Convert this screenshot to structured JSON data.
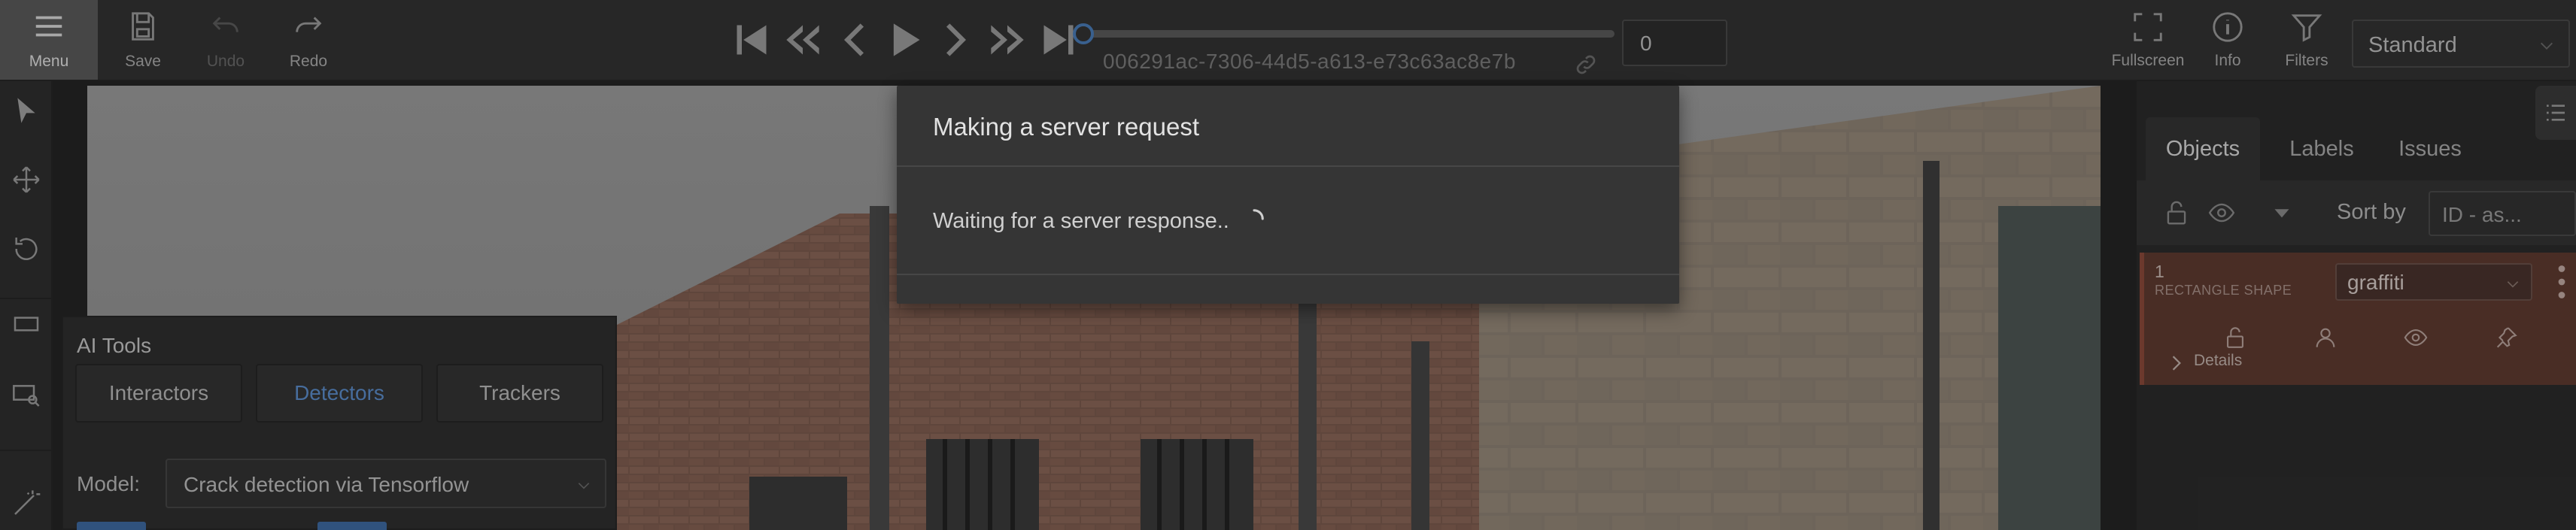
{
  "toolbar": {
    "menu_label": "Menu",
    "save_label": "Save",
    "undo_label": "Undo",
    "redo_label": "Redo"
  },
  "player": {
    "frame_id": "006291ac-7306-44d5-a613-e73c63ac8e7b",
    "frame_number": "0",
    "progress": 0
  },
  "right_toolbar": {
    "fullscreen_label": "Fullscreen",
    "info_label": "Info",
    "filters_label": "Filters",
    "workspace_value": "Standard"
  },
  "sidebar": {
    "tabs": [
      {
        "label": "Objects"
      },
      {
        "label": "Labels"
      },
      {
        "label": "Issues"
      }
    ],
    "sort_label": "Sort by",
    "sort_value": "ID - as...",
    "object": {
      "id": "1",
      "type": "RECTANGLE SHAPE",
      "label": "graffiti",
      "details_label": "Details",
      "color": "#8a4a3a"
    }
  },
  "ai_tools": {
    "title": "AI Tools",
    "tabs": [
      {
        "label": "Interactors"
      },
      {
        "label": "Detectors"
      },
      {
        "label": "Trackers"
      }
    ],
    "active_tab": "Detectors",
    "model_label": "Model:",
    "model_value": "Crack detection via Tensorflow"
  },
  "modal": {
    "title": "Making a server request",
    "body": "Waiting for a server response.."
  },
  "colors": {
    "accent": "#5b8cc9",
    "object_card": "#5e3a30"
  }
}
